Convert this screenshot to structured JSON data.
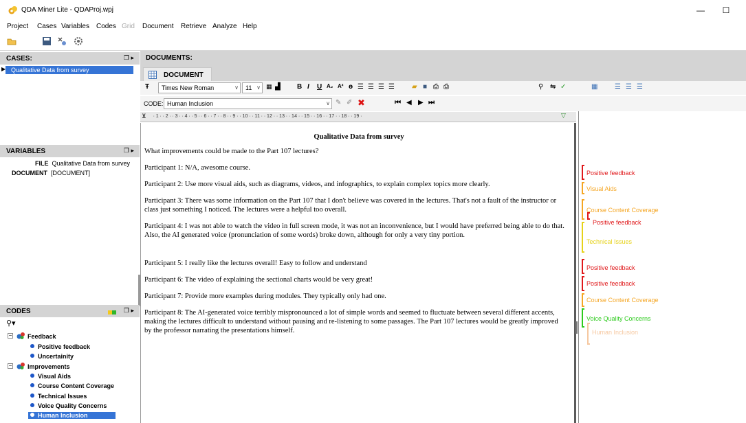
{
  "window": {
    "title": "QDA Miner Lite - QDAProj.wpj",
    "minimize_glyph": "—",
    "maximize_glyph": "☐"
  },
  "menu": {
    "items": [
      "Project",
      "Cases",
      "Variables",
      "Codes",
      "Grid",
      "Document",
      "Retrieve",
      "Analyze",
      "Help"
    ],
    "disabled": [
      "Grid"
    ]
  },
  "cases": {
    "header": "CASES:",
    "items": [
      "Qualitative Data from survey"
    ]
  },
  "variables": {
    "header": "VARIABLES",
    "rows": [
      {
        "name": "FILE",
        "value": "Qualitative Data from survey"
      },
      {
        "name": "DOCUMENT",
        "value": "[DOCUMENT]"
      }
    ]
  },
  "codes": {
    "header": "CODES",
    "tree": [
      {
        "label": "Feedback",
        "kind": "category",
        "children": [
          "Positive feedback",
          "Uncertainity"
        ]
      },
      {
        "label": "Improvements",
        "kind": "category",
        "children": [
          "Visual Aids",
          "Course Content Coverage",
          "Technical Issues",
          "Voice Quality Concerns",
          "Human Inclusion"
        ]
      }
    ],
    "selected": "Human Inclusion"
  },
  "documents": {
    "header": "DOCUMENTS:",
    "tab_label": "DOCUMENT",
    "font_name": "Times New Roman",
    "font_size": "11",
    "code_label": "CODE:",
    "code_value": "Human Inclusion",
    "ruler": " · 1 · · 2 · · 3 · · 4 · · 5 · · 6 · · 7 · · 8 · · 9 · · 10 · · 11 · · 12 · · 13 · · 14 · · 15 · · 16 · · 17 · · 18 · · 19 ·"
  },
  "document": {
    "title": "Qualitative Data from survey",
    "paragraphs": [
      "What improvements could be made to the Part 107 lectures?",
      "Participant 1: N/A, awesome course.",
      "Participant 2: Use more visual aids, such as diagrams, videos, and infographics, to explain complex topics more clearly.",
      "Participant 3: There was some information on the Part 107 that I don't believe was covered in the lectures. That's not a fault of the instructor or class just something I noticed. The lectures were a helpful too overall.",
      "Participant 4: I was not able to watch the video in full screen mode, it was not an inconvenience, but I would have preferred being able to do that. Also, the AI generated voice (pronunciation of some words) broke down, although for only a very tiny portion.",
      "Participant 5: I really like the lectures overall! Easy to follow and understand",
      "Participant 6: The video of explaining the sectional charts would be very great!",
      "Participant 7: Provide more examples during modules. They typically only had one.",
      "Participant 8: The AI-generated voice terribly mispronounced a lot of simple words and seemed to fluctuate between several different accents, making the lectures difficult to understand without pausing and re-listening to some passages. The Part 107 lectures would be greatly improved by the professor narrating the presentations himself."
    ]
  },
  "coding_margin": {
    "tags": [
      {
        "label": "Positive feedback",
        "color": "#e0191b"
      },
      {
        "label": "Visual Aids",
        "color": "#f5a623"
      },
      {
        "label": "Course Content Coverage",
        "color": "#f5a623"
      },
      {
        "label": "Positive feedback",
        "color": "#e0191b"
      },
      {
        "label": "Technical Issues",
        "color": "#e6d21a"
      },
      {
        "label": "Positive feedback",
        "color": "#e0191b"
      },
      {
        "label": "Positive feedback",
        "color": "#e0191b"
      },
      {
        "label": "Course Content Coverage",
        "color": "#f5a623"
      },
      {
        "label": "Voice Quality Concerns",
        "color": "#2ecb1e"
      },
      {
        "label": "Human Inclusion",
        "color": "#f6c8a0"
      }
    ]
  },
  "colors": {
    "selection": "#3574d6",
    "pane_header": "#d4d4d4"
  }
}
